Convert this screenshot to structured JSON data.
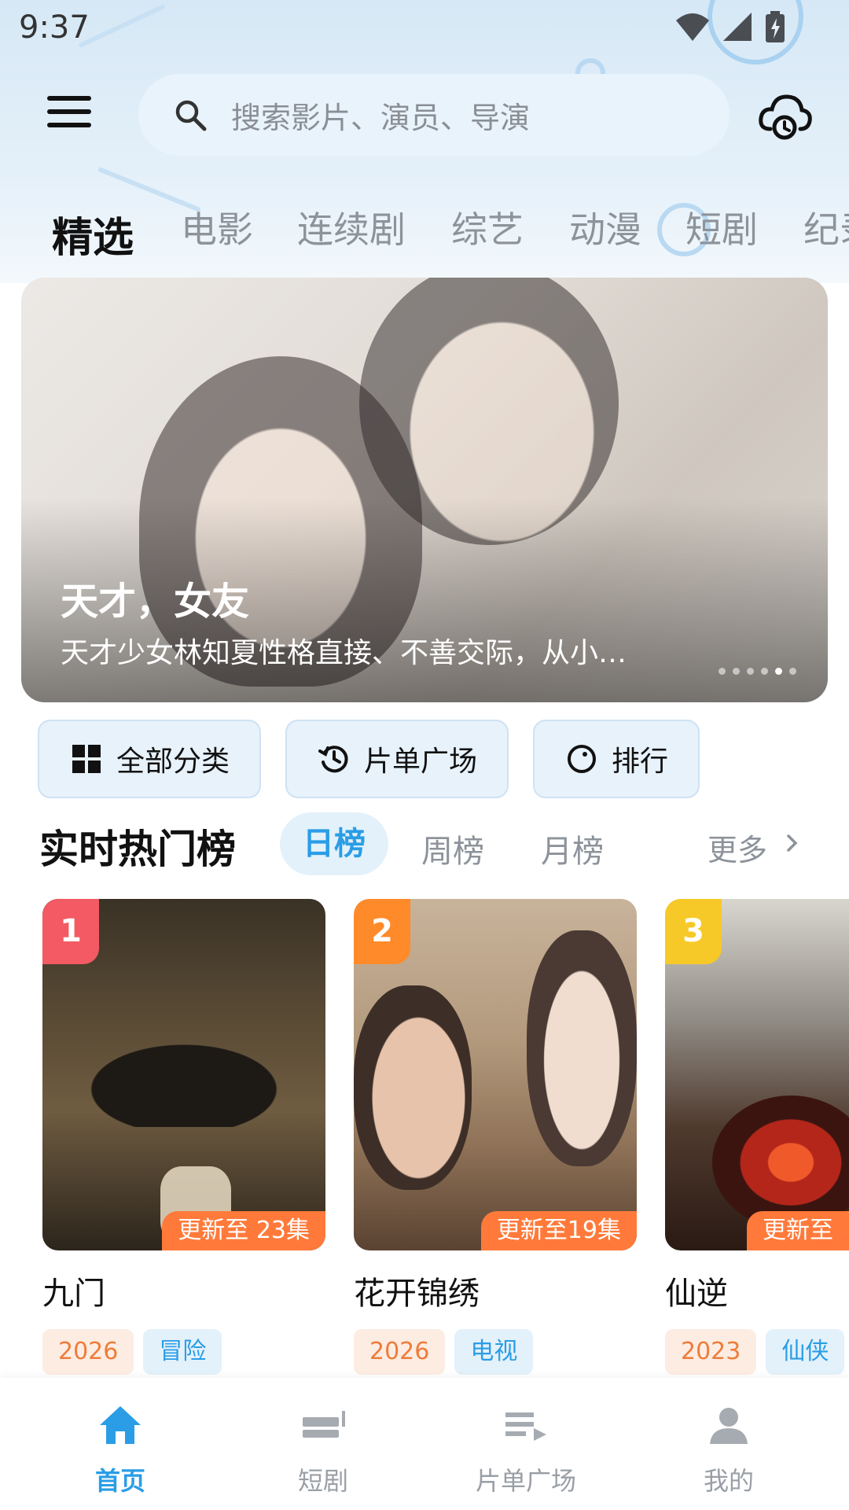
{
  "status": {
    "time": "9:37"
  },
  "search": {
    "placeholder": "搜索影片、演员、导演"
  },
  "tabs": [
    {
      "label": "精选",
      "active": true
    },
    {
      "label": "电影"
    },
    {
      "label": "连续剧"
    },
    {
      "label": "综艺"
    },
    {
      "label": "动漫"
    },
    {
      "label": "短剧"
    },
    {
      "label": "纪录"
    }
  ],
  "banner": {
    "title": "天才，女友",
    "desc": "天才少女林知夏性格直接、不善交际，从小…",
    "slides": 6,
    "active_slide": 5
  },
  "quick": {
    "all_categories": "全部分类",
    "playlist_plaza": "片单广场",
    "ranking": "排行"
  },
  "hot": {
    "title": "实时热门榜",
    "tabs": [
      "日榜",
      "周榜",
      "月榜"
    ],
    "more": "更多"
  },
  "cards": [
    {
      "rank": "1",
      "update": "更新至 23集",
      "name": "九门",
      "year": "2026",
      "genre": "冒险",
      "rank_color": "#f35a63"
    },
    {
      "rank": "2",
      "update": "更新至19集",
      "name": "花开锦绣",
      "year": "2026",
      "genre": "电视",
      "rank_color": "#ff8a2a"
    },
    {
      "rank": "3",
      "update": "更新至",
      "name": "仙逆",
      "year": "2023",
      "genre": "仙侠",
      "rank_color": "#f7c928"
    }
  ],
  "nav": {
    "home": "首页",
    "short": "短剧",
    "playlist": "片单广场",
    "mine": "我的"
  },
  "colors": {
    "accent": "#2a9de6",
    "update_badge": "#ff7a3a"
  }
}
